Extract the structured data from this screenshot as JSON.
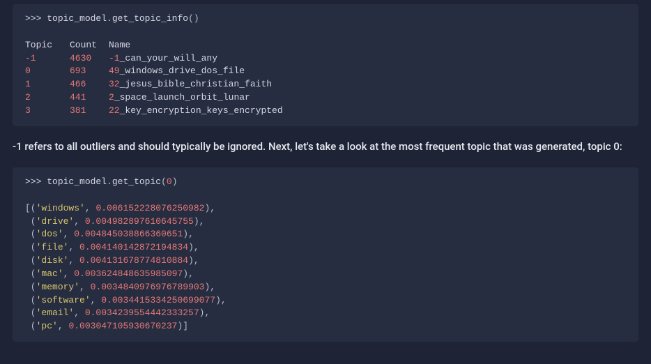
{
  "block1": {
    "cmd_prefix": ">>> ",
    "obj": "topic_model",
    "dot": ".",
    "method": "get_topic_info",
    "parens": "()",
    "headers": {
      "topic": "Topic",
      "count": "Count",
      "name": "Name"
    },
    "rows": [
      {
        "topic": "-1",
        "count": "4630",
        "prefix_num": "-1",
        "suffix": "_can_your_will_any"
      },
      {
        "topic": "0",
        "count": "693",
        "prefix_num": "49",
        "suffix": "_windows_drive_dos_file"
      },
      {
        "topic": "1",
        "count": "466",
        "prefix_num": "32",
        "suffix": "_jesus_bible_christian_faith"
      },
      {
        "topic": "2",
        "count": "441",
        "prefix_num": "2",
        "suffix": "_space_launch_orbit_lunar"
      },
      {
        "topic": "3",
        "count": "381",
        "prefix_num": "22",
        "suffix": "_key_encryption_keys_encrypted"
      }
    ]
  },
  "prose1": "-1 refers to all outliers and should typically be ignored. Next, let's take a look at the most frequent topic that was generated, topic 0:",
  "block2": {
    "cmd_prefix": ">>> ",
    "obj": "topic_model",
    "dot": ".",
    "method": "get_topic",
    "open": "(",
    "arg": "0",
    "close": ")",
    "list_open": "[",
    "list_close": "]",
    "items": [
      {
        "word": "'windows'",
        "val": "0.006152228076250982"
      },
      {
        "word": "'drive'",
        "val": "0.004982897610645755"
      },
      {
        "word": "'dos'",
        "val": "0.004845038866360651"
      },
      {
        "word": "'file'",
        "val": "0.004140142872194834"
      },
      {
        "word": "'disk'",
        "val": "0.004131678774810884"
      },
      {
        "word": "'mac'",
        "val": "0.003624848635985097"
      },
      {
        "word": "'memory'",
        "val": "0.0034840976976789903"
      },
      {
        "word": "'software'",
        "val": "0.0034415334250699077"
      },
      {
        "word": "'email'",
        "val": "0.0034239554442333257"
      },
      {
        "word": "'pc'",
        "val": "0.003047105930670237"
      }
    ]
  }
}
